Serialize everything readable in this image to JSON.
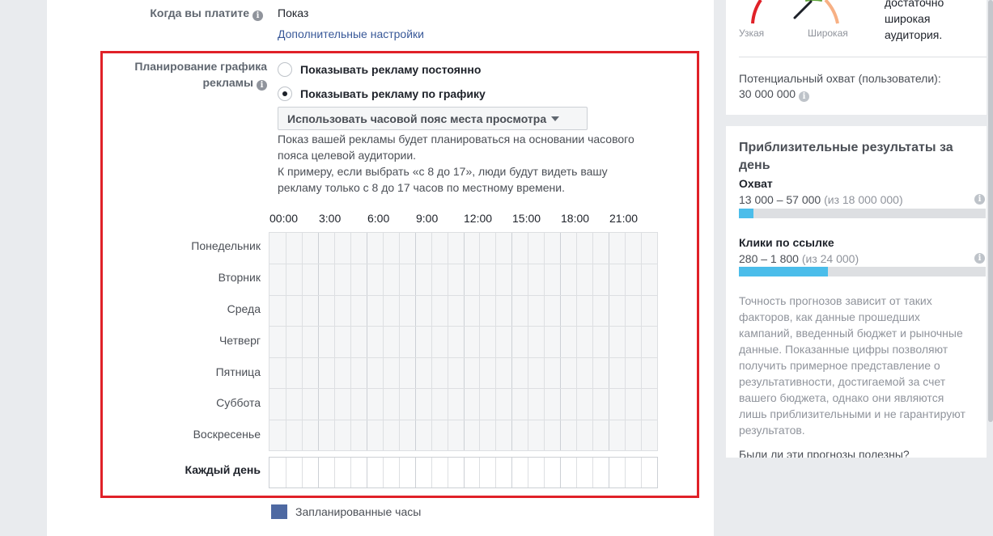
{
  "payment": {
    "label": "Когда вы платите",
    "value": "Показ",
    "more_settings_link": "Дополнительные настройки"
  },
  "schedule": {
    "label_line1": "Планирование графика",
    "label_line2": "рекламы",
    "option_continuous": "Показывать рекламу постоянно",
    "option_scheduled": "Показывать рекламу по графику",
    "selected_option": "option_scheduled",
    "timezone_dropdown": "Использовать часовой пояс места просмотра",
    "description": [
      "Показ вашей рекламы будет планироваться на основании часового",
      "пояса целевой аудитории.",
      "К примеру, если выбрать «с 8 до 17», люди будут видеть вашу",
      "рекламу только с 8 до 17 часов по местному времени."
    ],
    "hours": [
      "00:00",
      "3:00",
      "6:00",
      "9:00",
      "12:00",
      "15:00",
      "18:00",
      "21:00"
    ],
    "days": [
      "Понедельник",
      "Вторник",
      "Среда",
      "Четверг",
      "Пятница",
      "Суббота",
      "Воскресенье"
    ],
    "every_day": "Каждый день",
    "legend": "Запланированные часы",
    "scheduled_color": "#4e69a2"
  },
  "audience": {
    "gauge_narrow": "Узкая",
    "gauge_wide": "Широкая",
    "summary_lines": [
      "достаточно",
      "широкая",
      "аудитория."
    ],
    "potential_reach_label": "Потенциальный охват (пользователи):",
    "potential_reach_value": "30 000 000"
  },
  "estimates": {
    "title_line1": "Приблизительные результаты за",
    "title_line2": "день",
    "reach": {
      "label": "Охват",
      "range": "13 000 – 57 000",
      "total": "(из 18 000 000)",
      "fill_fraction": 0.06
    },
    "clicks": {
      "label": "Клики по ссылке",
      "range": "280 – 1 800",
      "total": "(из 24 000)",
      "fill_fraction": 0.36
    },
    "disclaimer": [
      "Точность прогнозов зависит от таких",
      "факторов, как данные прошедших",
      "кампаний, введенный бюджет и рыночные",
      "данные. Показанные цифры позволяют",
      "получить примерное представление о",
      "результативности, достигаемой за счет",
      "вашего бюджета, однако они являются",
      "лишь приблизительными и не гарантируют",
      "результатов."
    ],
    "feedback_link": "Были ли эти прогнозы полезны?",
    "bar_color": "#4bbdea"
  }
}
